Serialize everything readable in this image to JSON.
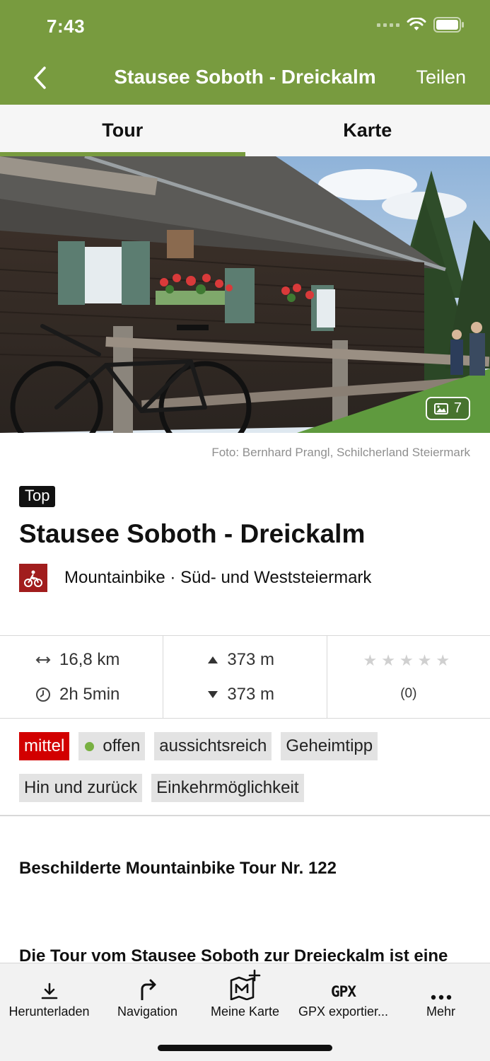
{
  "status_bar": {
    "time": "7:43"
  },
  "nav": {
    "title": "Stausee Soboth - Dreickalm",
    "share_label": "Teilen",
    "back_icon": "chevron-left-icon"
  },
  "tabs": [
    {
      "label": "Tour",
      "active": true
    },
    {
      "label": "Karte",
      "active": false
    }
  ],
  "hero": {
    "photo_count": "7",
    "credit": "Foto: Bernhard Prangl, Schilcherland Steiermark"
  },
  "tour": {
    "badge": "Top",
    "title": "Stausee Soboth - Dreickalm",
    "category": "Mountainbike · Süd- und Weststeiermark",
    "category_color": "#a11d1d"
  },
  "stats": {
    "distance": "16,8 km",
    "duration": "2h 5min",
    "ascent": "373 m",
    "descent": "373 m",
    "stars": "★★★★★",
    "rating_value": 0,
    "rating_count": "(0)"
  },
  "tags": [
    {
      "label": "mittel",
      "style": "red"
    },
    {
      "label": "offen",
      "style": "status",
      "dot_color": "#78b041"
    },
    {
      "label": "aussichtsreich",
      "style": "grey"
    },
    {
      "label": "Geheimtipp",
      "style": "grey"
    },
    {
      "label": "Hin und zurück",
      "style": "grey"
    },
    {
      "label": "Einkehrmöglichkeit",
      "style": "grey"
    }
  ],
  "content": {
    "subheading": "Beschilderte Mountainbike Tour Nr. 122",
    "description": "Die Tour vom Stausee Soboth zur Dreieckalm ist eine"
  },
  "toolbar": [
    {
      "label": "Herunterladen",
      "icon": "download-icon"
    },
    {
      "label": "Navigation",
      "icon": "turn-right-arrow-icon"
    },
    {
      "label": "Meine Karte",
      "icon": "map-add-icon"
    },
    {
      "label": "GPX exportier...",
      "icon_text": "GPX"
    },
    {
      "label": "Mehr",
      "icon": "more-dots-icon"
    }
  ],
  "colors": {
    "brand_green": "#789b3f",
    "difficulty_red": "#d20000",
    "open_green": "#78b041"
  }
}
